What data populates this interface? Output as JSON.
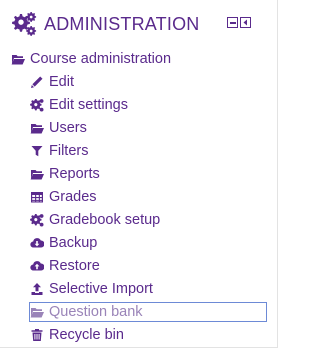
{
  "block": {
    "title": "ADMINISTRATION",
    "header_icon": "cogs-icon",
    "controls": [
      {
        "name": "minimize-control",
        "icon": "minimize-icon"
      },
      {
        "name": "dock-control",
        "icon": "dock-icon"
      }
    ]
  },
  "tree": {
    "root": {
      "label": "Course administration",
      "icon": "folder-open-icon"
    },
    "items": [
      {
        "label": "Edit",
        "icon": "pencil-icon"
      },
      {
        "label": "Edit settings",
        "icon": "cog-icon"
      },
      {
        "label": "Users",
        "icon": "folder-open-icon"
      },
      {
        "label": "Filters",
        "icon": "filter-icon"
      },
      {
        "label": "Reports",
        "icon": "folder-open-icon"
      },
      {
        "label": "Grades",
        "icon": "table-icon"
      },
      {
        "label": "Gradebook setup",
        "icon": "cog-icon"
      },
      {
        "label": "Backup",
        "icon": "cloud-download-icon"
      },
      {
        "label": "Restore",
        "icon": "cloud-upload-icon"
      },
      {
        "label": "Selective Import",
        "icon": "upload-icon"
      },
      {
        "label": "Question bank",
        "icon": "folder-open-icon",
        "selected": true
      },
      {
        "label": "Recycle bin",
        "icon": "trash-icon"
      }
    ]
  },
  "colors": {
    "accent": "#5a2a8c",
    "selected_text": "#9a84b8",
    "selected_border": "#6d8ad6"
  }
}
